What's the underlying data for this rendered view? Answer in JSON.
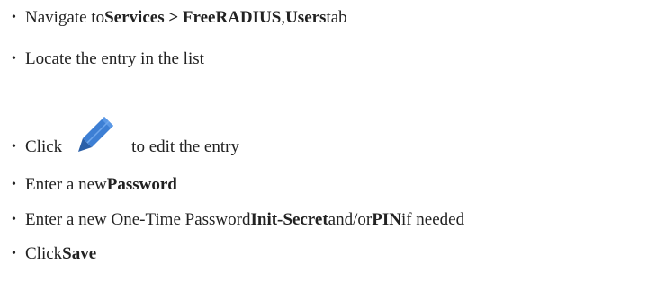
{
  "steps": [
    {
      "parts": [
        {
          "text": "Navigate to ",
          "bold": false
        },
        {
          "text": "Services > FreeRADIUS",
          "bold": true
        },
        {
          "text": ", ",
          "bold": false
        },
        {
          "text": "Users",
          "bold": true
        },
        {
          "text": " tab",
          "bold": false
        }
      ]
    },
    {
      "parts": [
        {
          "text": "Locate the entry in the list",
          "bold": false
        }
      ]
    },
    {
      "parts": [
        {
          "text": "Click",
          "bold": false
        },
        {
          "icon": "pencil-icon"
        },
        {
          "text": "to edit the entry",
          "bold": false
        }
      ]
    },
    {
      "parts": [
        {
          "text": "Enter a new ",
          "bold": false
        },
        {
          "text": "Password",
          "bold": true
        }
      ]
    },
    {
      "parts": [
        {
          "text": "Enter a new One-Time Password ",
          "bold": false
        },
        {
          "text": "Init-Secret",
          "bold": true
        },
        {
          "text": " and/or ",
          "bold": false
        },
        {
          "text": "PIN",
          "bold": true
        },
        {
          "text": " if needed",
          "bold": false
        }
      ]
    },
    {
      "parts": [
        {
          "text": "Click ",
          "bold": false
        },
        {
          "text": "Save",
          "bold": true
        }
      ]
    }
  ],
  "bullet_char": "•",
  "colors": {
    "text": "#222222",
    "pencil_fill": "#3d7fd4",
    "pencil_tip": "#2a5fa8"
  }
}
